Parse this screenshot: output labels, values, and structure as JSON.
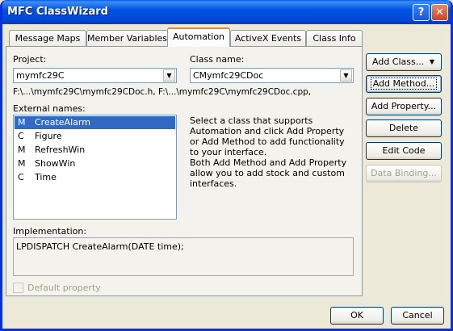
{
  "window": {
    "title": "MFC ClassWizard",
    "help_glyph": "?",
    "close_glyph": "✕"
  },
  "tabs": [
    {
      "label": "Message Maps"
    },
    {
      "label": "Member Variables"
    },
    {
      "label": "Automation"
    },
    {
      "label": "ActiveX Events"
    },
    {
      "label": "Class Info"
    }
  ],
  "project": {
    "label": "Project:",
    "value": "mymfc29C"
  },
  "class_name": {
    "label": "Class name:",
    "value": "CMymfc29CDoc"
  },
  "file_path": "F:\\...\\mymfc29C\\mymfc29CDoc.h, F:\\...\\mymfc29C\\mymfc29CDoc.cpp,",
  "external_names": {
    "label": "External names:",
    "items": [
      {
        "kind": "M",
        "name": "CreateAlarm",
        "selected": true
      },
      {
        "kind": "C",
        "name": "Figure"
      },
      {
        "kind": "M",
        "name": "RefreshWin"
      },
      {
        "kind": "M",
        "name": "ShowWin"
      },
      {
        "kind": "C",
        "name": "Time"
      }
    ]
  },
  "description": {
    "p1": "Select a class that supports Automation and click Add Property or Add Method to add functionality to your interface.",
    "p2": "Both Add Method and Add Property allow you to add stock and custom interfaces."
  },
  "implementation": {
    "label": "Implementation:",
    "value": "LPDISPATCH CreateAlarm(DATE time);"
  },
  "default_property": {
    "label": "Default property"
  },
  "buttons": {
    "add_class": "Add Class...",
    "add_class_arrow": "▼",
    "add_method": "Add Method...",
    "add_property": "Add Property...",
    "delete": "Delete",
    "edit_code": "Edit Code",
    "data_binding": "Data Binding...",
    "ok": "OK",
    "cancel": "Cancel"
  },
  "combo_arrow": "▼"
}
